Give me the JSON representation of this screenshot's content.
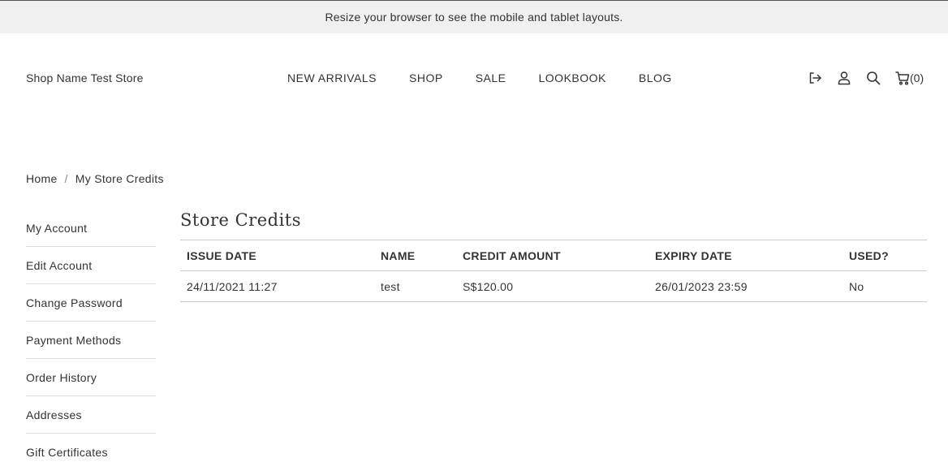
{
  "announcement": "Resize your browser to see the mobile and tablet layouts.",
  "header": {
    "shop_name": "Shop Name Test Store",
    "nav": [
      "NEW ARRIVALS",
      "SHOP",
      "SALE",
      "LOOKBOOK",
      "BLOG"
    ],
    "icons": {
      "logout": "logout-icon",
      "account": "user-icon",
      "search": "search-icon",
      "cart": "cart-icon"
    },
    "cart_count": "(0)"
  },
  "breadcrumb": {
    "home": "Home",
    "separator": "/",
    "current": "My Store Credits"
  },
  "sidebar": {
    "items": [
      "My Account",
      "Edit Account",
      "Change Password",
      "Payment Methods",
      "Order History",
      "Addresses",
      "Gift Certificates"
    ]
  },
  "content": {
    "title": "Store Credits",
    "columns": [
      "ISSUE DATE",
      "NAME",
      "CREDIT AMOUNT",
      "EXPIRY DATE",
      "USED?"
    ],
    "rows": [
      [
        "24/11/2021 11:27",
        "test",
        "S$120.00",
        "26/01/2023 23:59",
        "No"
      ]
    ]
  }
}
